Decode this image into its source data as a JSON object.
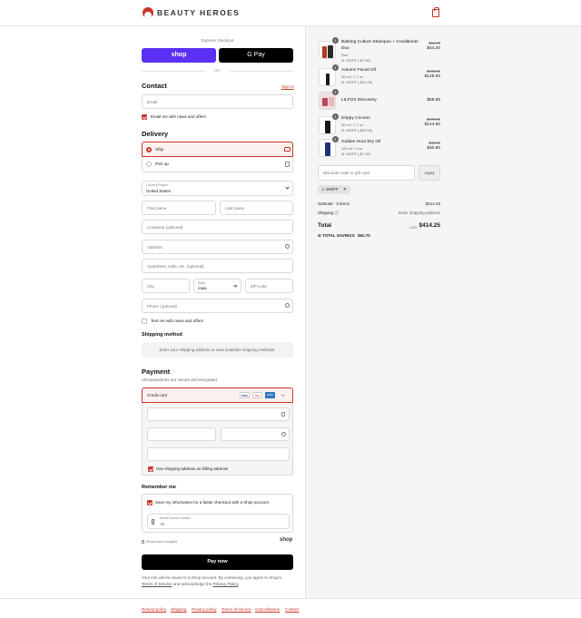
{
  "header": {
    "brand": "BEAUTY HEROES"
  },
  "express": {
    "title": "Express checkout",
    "shop_label": "shop",
    "gpay_label": "G Pay",
    "or": "OR"
  },
  "contact": {
    "title": "Contact",
    "signin": "Sign in",
    "email_placeholder": "Email",
    "news_label": "Email me with news and offers"
  },
  "delivery": {
    "title": "Delivery",
    "ship": "Ship",
    "pickup": "Pick up",
    "country_label": "Country/Region",
    "country": "United States",
    "first": "First name",
    "last": "Last name",
    "company": "Company (optional)",
    "address": "Address",
    "apartment": "Apartment, suite, etc. (optional)",
    "city": "City",
    "state_label": "State",
    "state": "Iowa",
    "zip": "ZIP code",
    "phone": "Phone (optional)",
    "text_label": "Text me with news and offers"
  },
  "shipping": {
    "title": "Shipping method",
    "note": "Enter your shipping address to view available shipping methods."
  },
  "payment": {
    "title": "Payment",
    "subtitle": "All transactions are secure and encrypted.",
    "method": "Credit card",
    "cards": [
      "VISA",
      "MC",
      "AMEX",
      "+4"
    ],
    "billing_label": "Use shipping address as billing address"
  },
  "remember": {
    "title": "Remember me",
    "save_label": "Save my information for a faster checkout with a Shop account",
    "mobile_label": "Mobile phone number",
    "mobile_value": "+1",
    "secure": "Secure and encrypted",
    "shop": "shop"
  },
  "pay_now": "Pay now",
  "legal": {
    "line1": "Your info will be saved to a Shop account. By continuing, you agree to Shop's",
    "terms": "Terms of Service",
    "and": " and acknowledge the ",
    "privacy": "Privacy Policy",
    "end": "."
  },
  "order": {
    "items": [
      {
        "qty": "1",
        "name": "Bathing Culture Shampoo + Conditioner Duo",
        "variant": "Duo",
        "discount": "15OFF (-$7.80)",
        "strike": "$52.00",
        "price": "$44.20"
      },
      {
        "qty": "1",
        "name": "Autumn Facial Oil",
        "variant": "30 ml / 1.7 oz",
        "discount": "15OFF (-$23.25)",
        "strike": "$148.25",
        "price": "$125.00"
      },
      {
        "qty": "1",
        "name": "LILFOX Discovery",
        "variant": "",
        "discount": "",
        "strike": "",
        "price": "$58.95"
      },
      {
        "qty": "1",
        "name": "Drippy Cocoon",
        "variant": "50 ml / 1.7 oz",
        "discount": "15OFF (-$25.50)",
        "strike": "$170.00",
        "price": "$144.50"
      },
      {
        "qty": "1",
        "name": "Golden Hour Dry Oil",
        "variant": "100 ml / 3 oz",
        "discount": "15OFF (-$7.20)",
        "strike": "$48.00",
        "price": "$40.80"
      }
    ],
    "discount_placeholder": "Discount code or gift card",
    "apply": "Apply",
    "code": "15OFF",
    "subtotal_label": "Subtotal · 5 items",
    "subtotal": "$414.25",
    "shipping_label": "Shipping",
    "shipping_value": "Enter shipping address",
    "total_label": "Total",
    "currency": "USD",
    "total": "$414.25",
    "savings_label": "TOTAL SAVINGS",
    "savings": "$62.70"
  },
  "footer": [
    "Refund policy",
    "Shipping",
    "Privacy policy",
    "Terms of service",
    "Cancellations",
    "Contact"
  ],
  "colors": {
    "accent": "#c8352b",
    "shop": "#5a31f4"
  }
}
